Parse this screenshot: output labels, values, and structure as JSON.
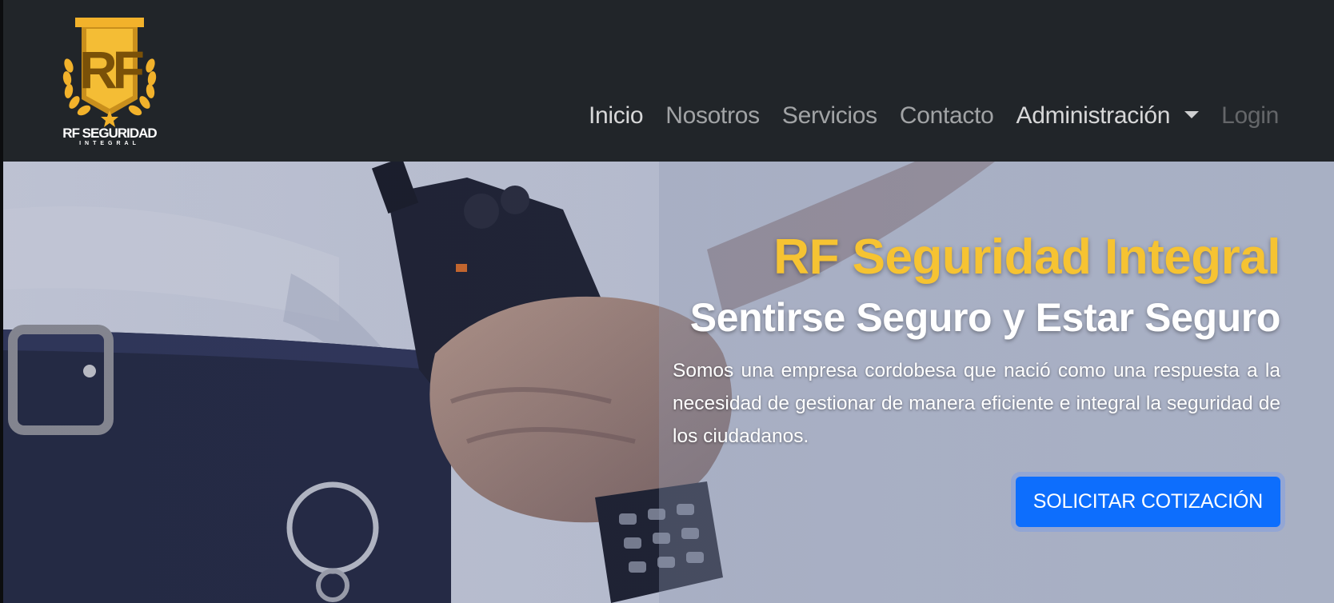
{
  "brand": {
    "logo_text": "RF SEGURIDAD",
    "logo_subtext": "INTEGRAL",
    "logo_monogram": "RF",
    "logo_color": "#f2b22b"
  },
  "nav": {
    "items": [
      {
        "label": "Inicio"
      },
      {
        "label": "Nosotros"
      },
      {
        "label": "Servicios"
      },
      {
        "label": "Contacto"
      },
      {
        "label": "Administración"
      },
      {
        "label": "Login"
      }
    ]
  },
  "hero": {
    "title": "RF Seguridad Integral",
    "subtitle": "Sentirse Seguro y Estar Seguro",
    "text": "Somos una empresa cordobesa que nació como una respuesta a la necesidad de gestionar de manera eficiente e integral la seguridad de los ciudadanos.",
    "cta_label": "SOLICITAR COTIZACIÓN"
  },
  "colors": {
    "navbar_bg": "#212529",
    "accent_yellow": "#f6c332",
    "button_blue": "#0d6efd"
  }
}
